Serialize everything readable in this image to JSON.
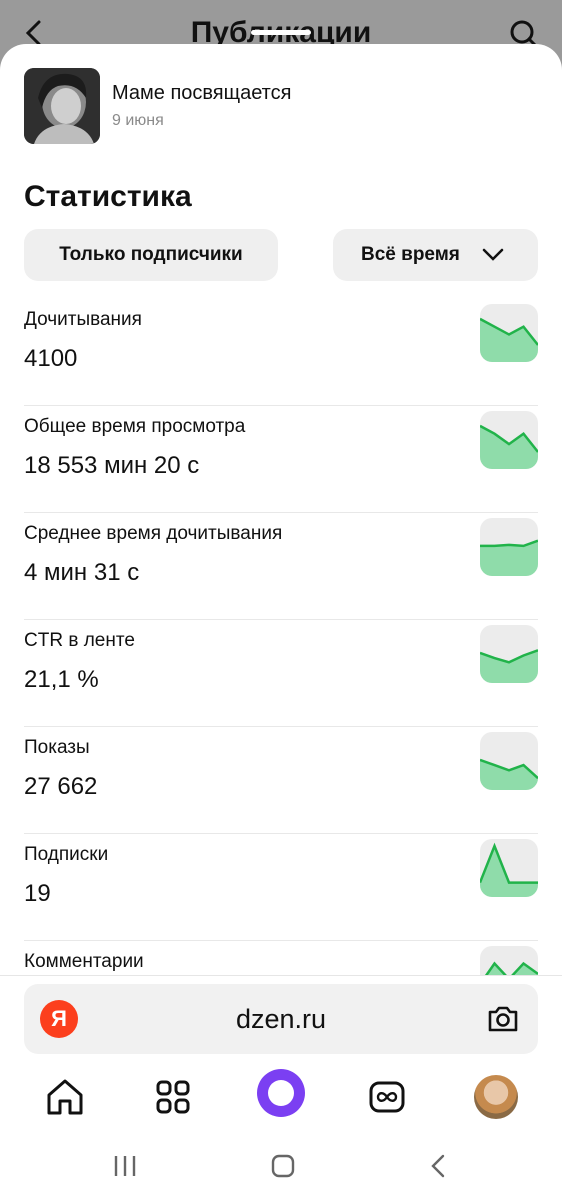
{
  "topbar": {
    "title": "Публикации",
    "back_icon": "chevron-left-icon",
    "search_icon": "search-icon"
  },
  "publication": {
    "title": "Маме посвящается",
    "date": "9 июня"
  },
  "statistics": {
    "heading": "Статистика",
    "filter_audience": "Только подписчики",
    "filter_period": "Всё время"
  },
  "metrics": [
    {
      "label": "Дочитывания",
      "value": "4100",
      "trend": [
        0.75,
        0.6,
        0.45,
        0.6,
        0.25
      ]
    },
    {
      "label": "Общее время просмотра",
      "value": "18 553 мин 20 с",
      "trend": [
        0.75,
        0.6,
        0.4,
        0.6,
        0.25
      ]
    },
    {
      "label": "Среднее время дочитывания",
      "value": "4 мин 31 с",
      "trend": [
        0.5,
        0.5,
        0.52,
        0.5,
        0.6
      ]
    },
    {
      "label": "CTR в ленте",
      "value": "21,1 %",
      "trend": [
        0.5,
        0.4,
        0.32,
        0.45,
        0.55
      ]
    },
    {
      "label": "Показы",
      "value": "27 662",
      "trend": [
        0.5,
        0.4,
        0.3,
        0.4,
        0.15
      ]
    },
    {
      "label": "Подписки",
      "value": "19",
      "trend": [
        0.2,
        0.9,
        0.2,
        0.2,
        0.2
      ]
    },
    {
      "label": "Комментарии",
      "value": "",
      "trend": [
        0.3,
        0.7,
        0.4,
        0.7,
        0.5
      ]
    }
  ],
  "address_bar": {
    "brand_letter": "Я",
    "url": "dzen.ru",
    "camera_icon": "camera-icon"
  },
  "bottom_nav": [
    "home-icon",
    "apps-grid-icon",
    "alice-icon",
    "video-loop-icon",
    "profile-avatar"
  ],
  "colors": {
    "accent_green": "#21b34a",
    "spark_fill": "#8fdcaa",
    "alice_purple": "#7b3ff2",
    "yandex_red": "#fc3f1d"
  }
}
